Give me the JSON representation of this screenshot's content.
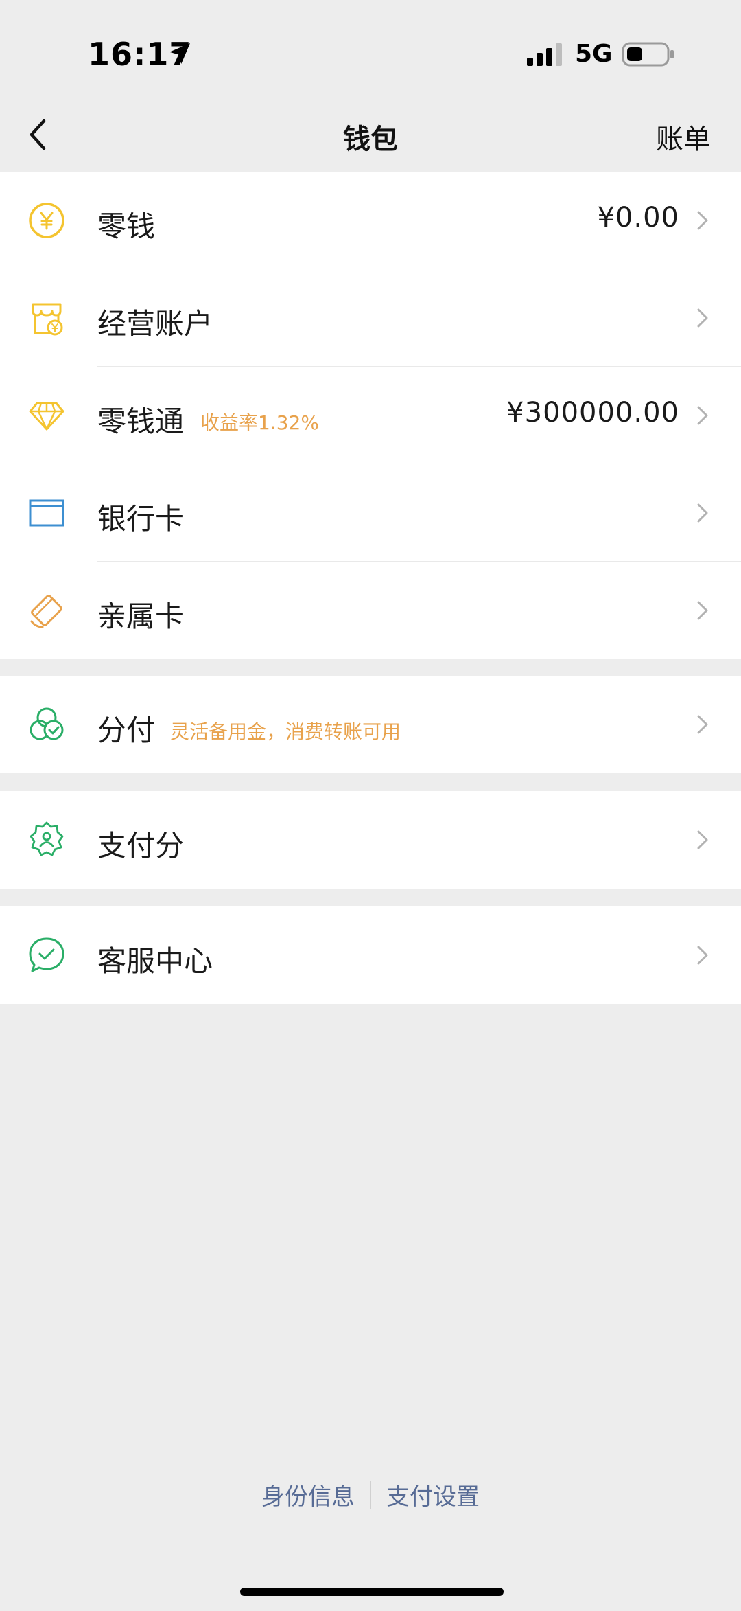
{
  "status_bar": {
    "time": "16:17",
    "network": "5G",
    "icons": [
      "location-arrow-icon",
      "signal-bars-icon",
      "battery-icon"
    ]
  },
  "nav": {
    "back_icon": "chevron-left-icon",
    "title": "钱包",
    "right_label": "账单"
  },
  "groups": [
    {
      "items": [
        {
          "label": "零钱",
          "value": "¥0.00",
          "icon": "yuan-coin-icon"
        },
        {
          "label": "经营账户",
          "icon": "shop-icon"
        },
        {
          "label": "零钱通",
          "tag": "收益率1.32%",
          "value": "¥300000.00",
          "icon": "diamond-icon"
        },
        {
          "label": "银行卡",
          "icon": "bank-card-icon"
        },
        {
          "label": "亲属卡",
          "icon": "family-card-icon"
        }
      ]
    },
    {
      "items": [
        {
          "label": "分付",
          "tag": "灵活备用金，消费转账可用",
          "icon": "fenfu-icon"
        }
      ]
    },
    {
      "items": [
        {
          "label": "支付分",
          "icon": "pay-score-icon"
        }
      ]
    },
    {
      "items": [
        {
          "label": "客服中心",
          "icon": "customer-service-icon"
        }
      ]
    }
  ],
  "footer": {
    "links": [
      "身份信息",
      "支付设置"
    ]
  },
  "colors": {
    "background": "#ededed",
    "accent_yellow": "#f4c430",
    "accent_green": "#2aae67",
    "accent_blue": "#3d8fd1",
    "accent_orange": "#e8a24c",
    "tag_text": "#e8a24c",
    "link_text": "#576b95"
  }
}
